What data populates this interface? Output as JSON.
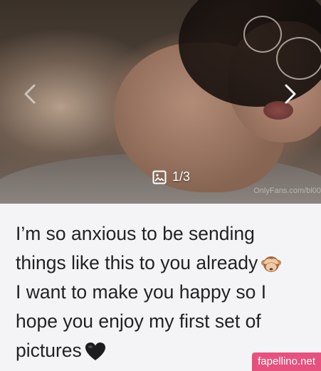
{
  "media": {
    "counter": "1/3",
    "watermark": "OnlyFans.com/bl00",
    "icons": {
      "prev": "chevron-left-icon",
      "next": "chevron-right-icon",
      "counter": "image-icon"
    }
  },
  "caption": {
    "line1": "I’m so anxious to be sending",
    "line2": "things like this to you already",
    "line3": "I want to make you happy so I",
    "line4": "hope you enjoy my first set of",
    "line5": "pictures",
    "emoji_1": "see-no-evil-monkey-icon",
    "emoji_2": "black-heart-icon"
  },
  "badge": {
    "label": "fapellino.net"
  },
  "colors": {
    "badge_bg": "#e7517e",
    "caption_bg": "#f4f4f6",
    "caption_text": "#222226"
  }
}
